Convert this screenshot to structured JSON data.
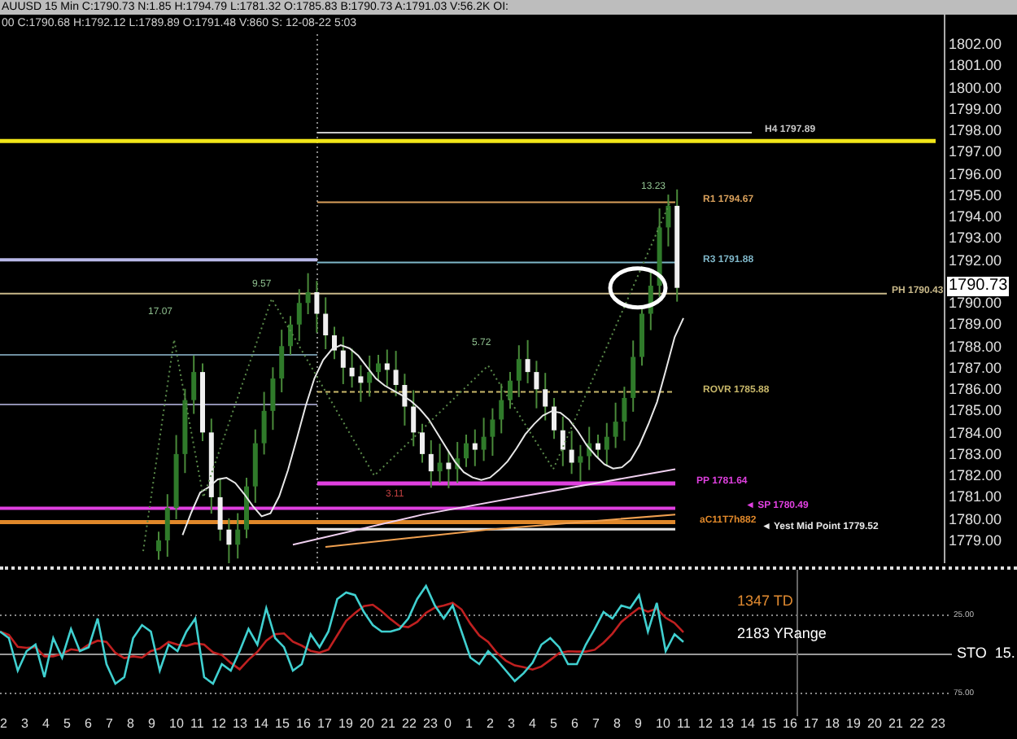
{
  "header": {
    "title": "AUUSD 15 Min C:1790.73 N:1.85 H:1794.79 L:1781.32 O:1785.83 B:1790.73 A:1791.03 V:56.2K OI:",
    "bar_info": "00 C:1790.68 H:1792.12 L:1789.89 O:1791.48 V:860 S: 12-08-22 5:03"
  },
  "price_chart": {
    "price_labels": [
      "1802.00",
      "1801.00",
      "1800.00",
      "1799.00",
      "1798.00",
      "1797.00",
      "1796.00",
      "1795.00",
      "1794.00",
      "1793.00",
      "1792.00",
      "1790.00",
      "1789.00",
      "1788.00",
      "1787.00",
      "1786.00",
      "1785.00",
      "1784.00",
      "1783.00",
      "1782.00",
      "1781.00",
      "1780.00",
      "1779.00"
    ],
    "current_price": "1790.73",
    "levels": [
      {
        "label": "H4 1797.89",
        "color": "#c8c8c8"
      },
      {
        "label": "R1 1794.67",
        "color": "#d9a05b"
      },
      {
        "label": "R3 1791.88",
        "color": "#7fb7c9"
      },
      {
        "label": "PH 1790.43",
        "color": "#c9b98a"
      },
      {
        "label": "ROVR 1785.88",
        "color": "#c9b86a"
      },
      {
        "label": "PP 1781.64",
        "color": "#e040e0"
      },
      {
        "label": "◄ SP 1780.49",
        "color": "#e040e0"
      },
      {
        "label": "aC11T7h882",
        "color": "#e0882a"
      },
      {
        "label": "◄ Yest Mid Point 1779.52",
        "color": "#e8e8e8"
      }
    ],
    "swing_labels": [
      "17.07",
      "9.57",
      "5.72",
      "13.23",
      "3.11"
    ]
  },
  "stochastic": {
    "td": "1347 TD",
    "yrange": "2183 YRange",
    "name": "STO  15.",
    "levels": [
      "25.00",
      "75.00"
    ]
  },
  "time_axis": [
    "2",
    "3",
    "4",
    "5",
    "6",
    "7",
    "8",
    "9",
    "10",
    "11",
    "12",
    "13",
    "14",
    "15",
    "16",
    "17",
    "19",
    "20",
    "21",
    "22",
    "23",
    "0",
    "1",
    "2",
    "3",
    "4",
    "5",
    "6",
    "7",
    "8",
    "9",
    "10",
    "11",
    "12",
    "13",
    "14",
    "15",
    "16",
    "17",
    "18",
    "19",
    "20",
    "21",
    "22",
    "23"
  ]
}
